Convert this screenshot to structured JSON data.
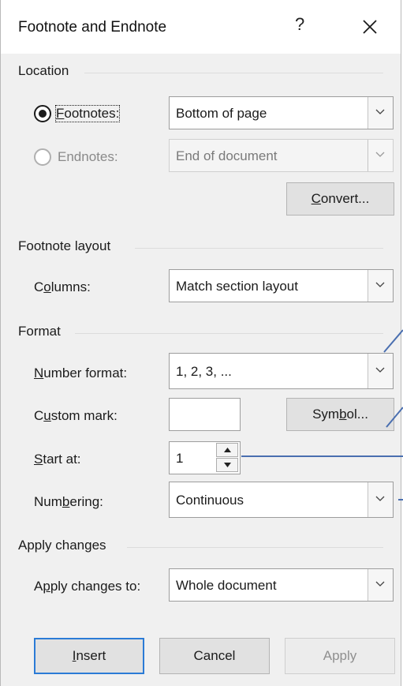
{
  "dialog": {
    "title": "Footnote and Endnote",
    "help_label": "?"
  },
  "location": {
    "group_label": "Location",
    "footnotes": {
      "label_pre": "",
      "mnemonic": "F",
      "label_post": "ootnotes:",
      "selected": true,
      "value": "Bottom of page"
    },
    "endnotes": {
      "label": "Endnotes:",
      "value": "End of document",
      "enabled": false
    },
    "convert_button": {
      "mnemonic": "C",
      "label_post": "onvert..."
    }
  },
  "footnote_layout": {
    "group_label": "Footnote layout",
    "columns": {
      "label_pre": "C",
      "mnemonic": "o",
      "label_post": "lumns:",
      "value": "Match section layout"
    }
  },
  "format": {
    "group_label": "Format",
    "number_format": {
      "label_pre": "",
      "mnemonic": "N",
      "label_post": "umber format:",
      "value": "1, 2, 3, ..."
    },
    "custom_mark": {
      "label_pre": "C",
      "mnemonic": "u",
      "label_post": "stom mark:",
      "value": ""
    },
    "symbol_button": {
      "label_pre": "Sym",
      "mnemonic": "b",
      "label_post": "ol..."
    },
    "start_at": {
      "label_pre": "",
      "mnemonic": "S",
      "label_post": "tart at:",
      "value": "1"
    },
    "numbering": {
      "label_pre": "Num",
      "mnemonic": "b",
      "label_post": "ering:",
      "value": "Continuous"
    }
  },
  "apply_changes": {
    "group_label": "Apply changes",
    "apply_to": {
      "label_pre": "A",
      "mnemonic": "p",
      "label_post": "ply changes to:",
      "value": "Whole document"
    }
  },
  "buttons": {
    "insert": {
      "mnemonic": "I",
      "label_post": "nsert"
    },
    "cancel": "Cancel",
    "apply": "Apply"
  },
  "colors": {
    "callout_line": "#4a6fb0",
    "primary_border": "#2b7bd6"
  }
}
